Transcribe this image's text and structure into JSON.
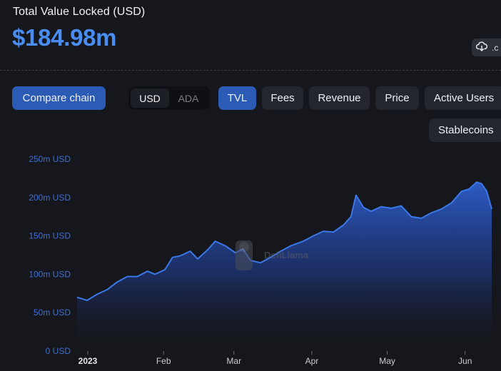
{
  "header": {
    "title": "Total Value Locked (USD)",
    "value": "$184.98m",
    "download_label": ".c"
  },
  "toolbar": {
    "compare_label": "Compare chain",
    "currency_options": [
      "USD",
      "ADA"
    ],
    "currency_selected": "USD",
    "metrics": [
      "TVL",
      "Fees",
      "Revenue",
      "Price",
      "Active Users",
      "Stablecoins"
    ],
    "metric_selected": "TVL"
  },
  "watermark": "DefiLlama",
  "colors": {
    "accent": "#4a8df0",
    "button_active": "#2c5bb5",
    "series": "#3b78e7"
  },
  "chart_data": {
    "type": "area",
    "title": "",
    "xlabel": "",
    "ylabel": "",
    "ylim": [
      0,
      250
    ],
    "y_unit": "m USD",
    "y_ticks": [
      "250m USD",
      "200m USD",
      "150m USD",
      "100m USD",
      "50m USD",
      "0 USD"
    ],
    "x_ticks": [
      "2023",
      "Feb",
      "Mar",
      "Apr",
      "May",
      "Jun"
    ],
    "grid": false,
    "series": [
      {
        "values": [
          [
            "2023-01-01",
            70
          ],
          [
            "2023-01-05",
            66
          ],
          [
            "2023-01-09",
            74
          ],
          [
            "2023-01-13",
            80
          ],
          [
            "2023-01-17",
            90
          ],
          [
            "2023-01-21",
            97
          ],
          [
            "2023-01-25",
            97
          ],
          [
            "2023-01-29",
            104
          ],
          [
            "2023-02-01",
            100
          ],
          [
            "2023-02-05",
            106
          ],
          [
            "2023-02-08",
            122
          ],
          [
            "2023-02-11",
            124
          ],
          [
            "2023-02-15",
            130
          ],
          [
            "2023-02-18",
            120
          ],
          [
            "2023-02-22",
            132
          ],
          [
            "2023-02-25",
            143
          ],
          [
            "2023-03-01",
            137
          ],
          [
            "2023-03-05",
            128
          ],
          [
            "2023-03-08",
            133
          ],
          [
            "2023-03-11",
            118
          ],
          [
            "2023-03-15",
            115
          ],
          [
            "2023-03-19",
            122
          ],
          [
            "2023-03-23",
            130
          ],
          [
            "2023-03-27",
            137
          ],
          [
            "2023-04-01",
            143
          ],
          [
            "2023-04-05",
            150
          ],
          [
            "2023-04-09",
            156
          ],
          [
            "2023-04-13",
            155
          ],
          [
            "2023-04-17",
            164
          ],
          [
            "2023-04-20",
            175
          ],
          [
            "2023-04-22",
            203
          ],
          [
            "2023-04-25",
            187
          ],
          [
            "2023-04-28",
            182
          ],
          [
            "2023-05-02",
            188
          ],
          [
            "2023-05-06",
            186
          ],
          [
            "2023-05-10",
            189
          ],
          [
            "2023-05-14",
            175
          ],
          [
            "2023-05-18",
            173
          ],
          [
            "2023-05-22",
            180
          ],
          [
            "2023-05-26",
            185
          ],
          [
            "2023-05-30",
            193
          ],
          [
            "2023-06-03",
            208
          ],
          [
            "2023-06-06",
            211
          ],
          [
            "2023-06-09",
            220
          ],
          [
            "2023-06-11",
            218
          ],
          [
            "2023-06-13",
            208
          ],
          [
            "2023-06-15",
            184.98
          ]
        ]
      }
    ]
  }
}
